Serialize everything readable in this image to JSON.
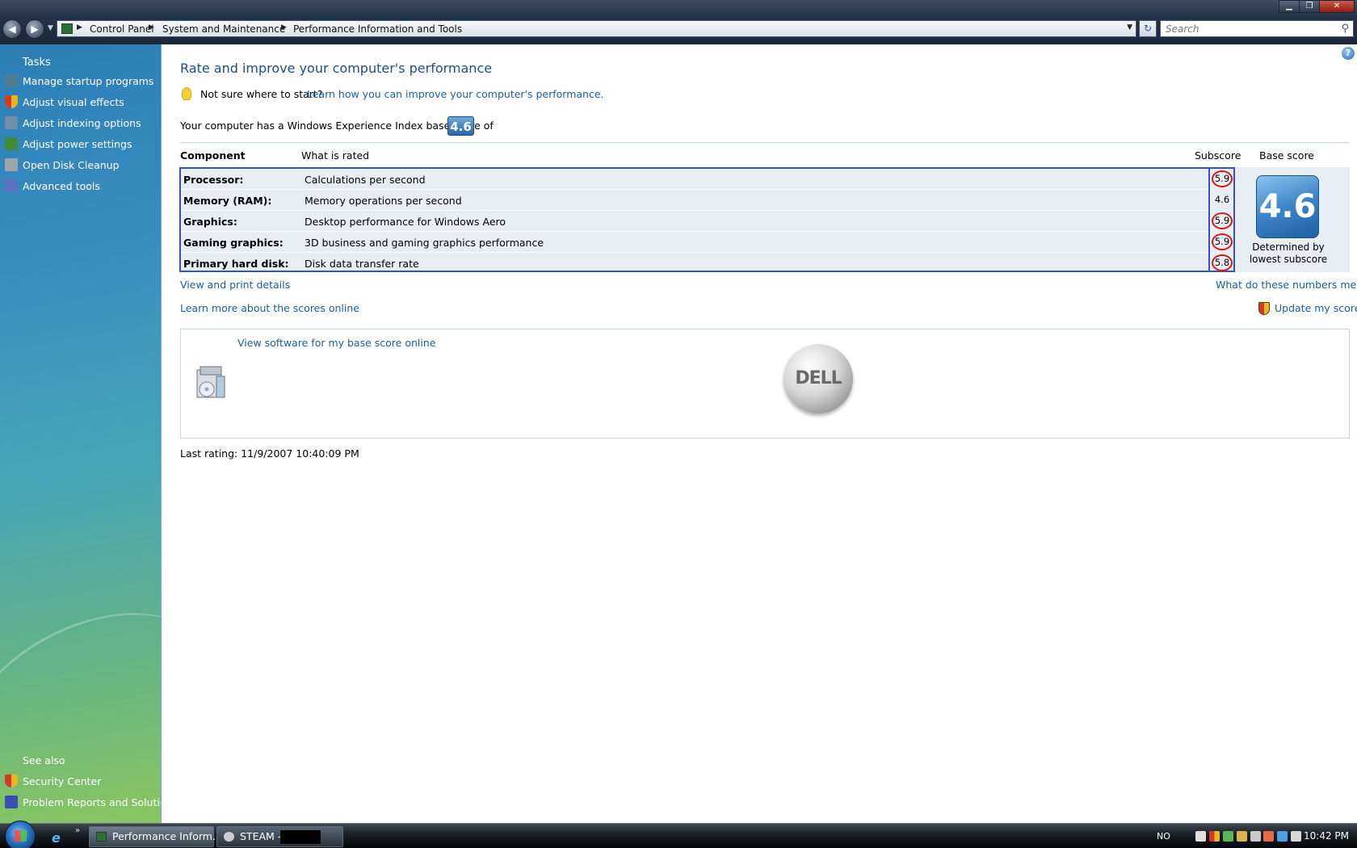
{
  "address_bar": {
    "crumbs": [
      "Control Panel",
      "System and Maintenance",
      "Performance Information and Tools"
    ],
    "search_placeholder": "Search"
  },
  "sidebar": {
    "tasks_heading": "Tasks",
    "items": [
      {
        "label": "Manage startup programs",
        "icon": "startup-icon"
      },
      {
        "label": "Adjust visual effects",
        "icon": "shield-icon"
      },
      {
        "label": "Adjust indexing options",
        "icon": "indexing-icon"
      },
      {
        "label": "Adjust power settings",
        "icon": "power-icon"
      },
      {
        "label": "Open Disk Cleanup",
        "icon": "disk-cleanup-icon"
      },
      {
        "label": "Advanced tools",
        "icon": "tools-icon"
      }
    ],
    "see_also_heading": "See also",
    "see_also": [
      {
        "label": "Security Center",
        "icon": "security-center-icon"
      },
      {
        "label": "Problem Reports and Solutions",
        "icon": "problem-reports-icon"
      }
    ]
  },
  "main": {
    "title": "Rate and improve your computer's performance",
    "tip_text": "Not sure where to start?",
    "tip_link": "Learn how you can improve your computer's performance.",
    "base_line": "Your computer has a Windows Experience Index base score of",
    "base_score": "4.6",
    "columns": {
      "component": "Component",
      "what_is_rated": "What is rated",
      "subscore": "Subscore",
      "base_score": "Base score"
    },
    "rows": [
      {
        "component": "Processor:",
        "rated": "Calculations per second",
        "subscore": "5.9",
        "circled": true
      },
      {
        "component": "Memory (RAM):",
        "rated": "Memory operations per second",
        "subscore": "4.6",
        "circled": false
      },
      {
        "component": "Graphics:",
        "rated": "Desktop performance for Windows Aero",
        "subscore": "5.9",
        "circled": true
      },
      {
        "component": "Gaming graphics:",
        "rated": "3D business and gaming graphics performance",
        "subscore": "5.9",
        "circled": true
      },
      {
        "component": "Primary hard disk:",
        "rated": "Disk data transfer rate",
        "subscore": "5.8",
        "circled": true
      }
    ],
    "base_caption_line1": "Determined by",
    "base_caption_line2": "lowest subscore",
    "view_print_link": "View and print details",
    "numbers_mean_link": "What do these numbers mean?",
    "learn_more_link": "Learn more about the scores online",
    "update_score_link": "Update my score",
    "software_link": "View software for my base score online",
    "dell_logo_text": "DELL",
    "last_rating": "Last rating: 11/9/2007 10:40:09 PM"
  },
  "taskbar": {
    "task_perf": "Performance Inform...",
    "task_steam": "STEAM -",
    "lang": "NO",
    "clock": "10:42 PM"
  },
  "colors": {
    "link": "#1a5ea8",
    "title": "#1a4f8b",
    "highlight_border": "#3150d6",
    "circle_red": "#d81818"
  }
}
